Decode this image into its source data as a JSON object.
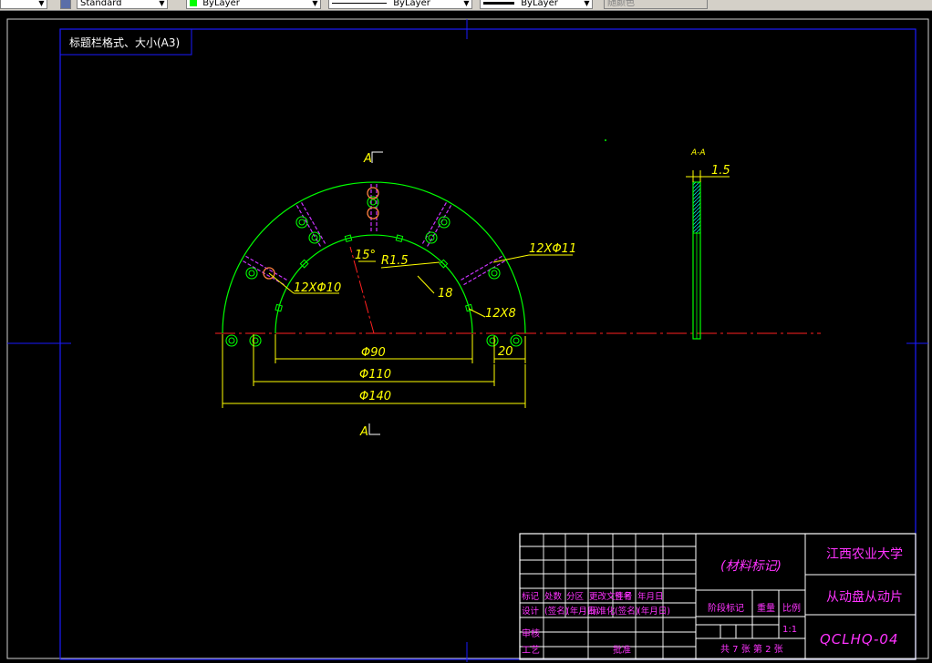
{
  "toolbar": {
    "textstyle": "Standard",
    "layer_color": "ByLayer",
    "linetype": "ByLayer",
    "lineweight": "ByLayer",
    "plotstyle": "随颜色"
  },
  "colors": {
    "background": "#000000",
    "frame": "#1a1aff",
    "outline": "#00ff00",
    "centerline": "#ff2020",
    "dimension": "#ffff00",
    "slots": "#cc33ff",
    "hatch": "#00ffff",
    "titleblock_text": "#ff33ff"
  },
  "drawing": {
    "format_label": "标题栏格式、大小(A3)",
    "section_mark_top": "A",
    "section_mark_bottom": "A",
    "section_label": "A-A",
    "dims": {
      "angle": "15°",
      "radius": "R1.5",
      "slot_depth": "18",
      "holes_outer": "12XΦ11",
      "holes_inner": "12XΦ10",
      "slots": "12X8",
      "width": "20",
      "d90": "Φ90",
      "d110": "Φ110",
      "d140": "Φ140",
      "thickness": "1.5"
    }
  },
  "titleblock": {
    "material": "(材料标记)",
    "school": "江西农业大学",
    "part_name": "从动盘从动片",
    "drawing_no": "QCLHQ-04",
    "scale": "1:1",
    "sheets": "共 7 张 第 2 张",
    "headers1": [
      "标记",
      "处数",
      "分区",
      "更改文件号",
      "签名",
      "年月日"
    ],
    "headers2": [
      "设计",
      "(签名)",
      "(年月日)",
      "标准化",
      "(签名)",
      "(年月日)"
    ],
    "stage_label": "阶段标记",
    "weight_label": "重量",
    "scale_label": "比例",
    "review": "审核",
    "process": "工艺",
    "approve": "批准"
  }
}
